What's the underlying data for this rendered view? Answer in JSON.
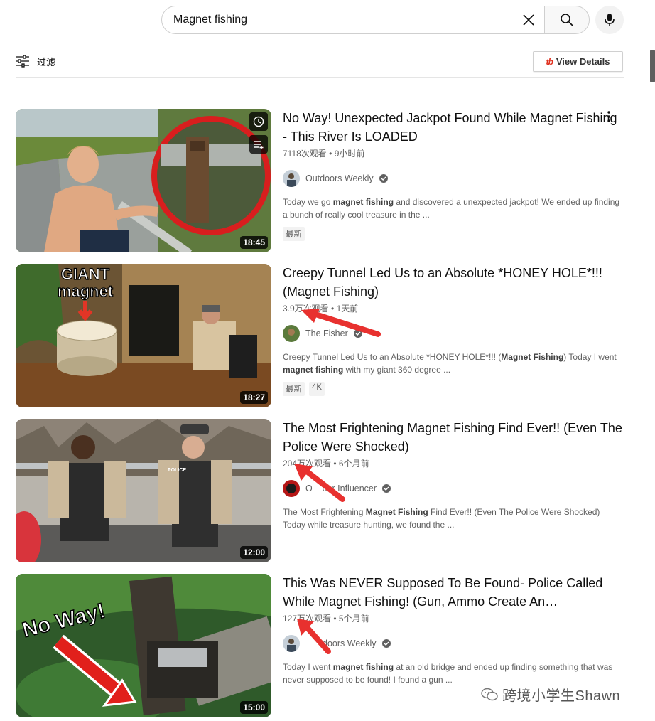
{
  "search": {
    "value": "Magnet fishing",
    "clear_icon": "close-icon",
    "search_icon": "search-icon",
    "mic_icon": "mic-icon"
  },
  "filter": {
    "label": "过滤",
    "icon": "sliders-icon"
  },
  "extension": {
    "logo": "tb",
    "label": "View Details"
  },
  "results": [
    {
      "title": "No Way! Unexpected Jackpot Found While Magnet Fishing - This River Is LOADED",
      "views": "7118次观看",
      "sep": "•",
      "age": "9小时前",
      "channel": "Outdoors Weekly",
      "desc_pre": "Today we go ",
      "desc_bold": "magnet fishing",
      "desc_post": " and discovered a unexpected jackpot! We ended up finding a bunch of really cool treasure in the ...",
      "badges": [
        "最新"
      ],
      "duration": "18:45"
    },
    {
      "title": "Creepy Tunnel Led Us to an Absolute *HONEY HOLE*!!! (Magnet Fishing)",
      "views": "3.9万次观看",
      "sep": "•",
      "age": "1天前",
      "channel": "The Fisher",
      "desc_a": "Creepy Tunnel Led Us to an Absolute *HONEY HOLE*!!! (",
      "desc_b": "Magnet Fishing",
      "desc_c": ") Today I went ",
      "desc_d": "magnet fishing",
      "desc_e": " with my giant 360 degree ...",
      "badges": [
        "最新",
        "4K"
      ],
      "duration": "18:27",
      "thumb_text_1": "GIANT",
      "thumb_text_2": "magnet"
    },
    {
      "title": "The Most Frightening Magnet Fishing Find Ever!! (Even The Police Were Shocked)",
      "views": "204万次观看",
      "sep": "•",
      "age": "6个月前",
      "channel": "Outdoor Influencer",
      "channel_visible": "O    oor Influencer",
      "desc_a": "The Most Frightening ",
      "desc_b": "Magnet Fishing",
      "desc_c": " Find Ever!! (Even The Police Were Shocked) Today while treasure hunting, we found the ...",
      "duration": "12:00",
      "thumb_text_1": "POLICE"
    },
    {
      "title": "This Was NEVER Supposed To Be Found- Police Called While Magnet Fishing! (Gun, Ammo Create An…",
      "views": "127万次观看",
      "sep": "•",
      "age": "5个月前",
      "channel": "Outdoors Weekly",
      "channel_visible": "doors Weekly",
      "desc_a": "Today I went ",
      "desc_b": "magnet fishing",
      "desc_c": " at an old bridge and ended up finding something that was never supposed to be found! I found a gun ...",
      "duration": "15:00",
      "thumb_text_1": "No Way!"
    }
  ],
  "watermark": {
    "text": "跨境小学生Shawn",
    "icon": "wechat-icon"
  },
  "colors": {
    "annotation_arrow": "#e8312f",
    "link_text": "#0f0f0f",
    "meta_text": "#606060"
  }
}
